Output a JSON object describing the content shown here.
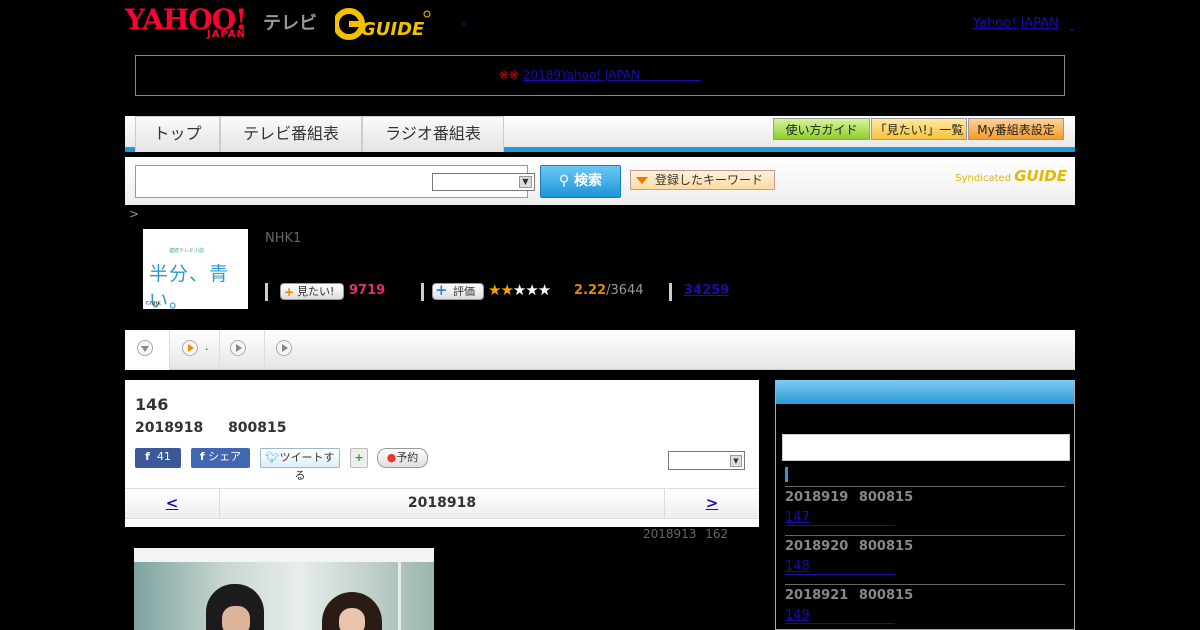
{
  "header": {
    "logo_yahoo": "YAHOO!",
    "logo_japan": "JAPAN",
    "logo_tv": "テレビ",
    "link": "Yahoo! JAPAN"
  },
  "notice": {
    "mark": "※※",
    "link": "20189Yahoo! JAPAN"
  },
  "nav": {
    "tabs": [
      "トップ",
      "テレビ番組表",
      "ラジオ番組表"
    ],
    "buttons": [
      "使い方ガイド",
      "「見たい!」一覧",
      "My番組表設定"
    ]
  },
  "search": {
    "button": "検索",
    "keyword": "登録したキーワード",
    "syndicated": "Syndicated",
    "syndicated_logo": "GUIDE"
  },
  "breadcrumb": ">",
  "program": {
    "thumb_small": "連続テレビ小説",
    "thumb_title": "半分、青い。",
    "thumb_copy": "©NHK",
    "channel": "NHK1",
    "want_label": "見たい!",
    "want_count": "9719",
    "rate_label": "評価",
    "rating": 2.22,
    "rating_text": "2.22",
    "rating_votes": "/3644",
    "reviews": "34259"
  },
  "player": {
    "sep": "."
  },
  "episode": {
    "number": "146",
    "datetime": "2018918 800815",
    "fb_count": "41",
    "fb_share": "シェア",
    "tweet": "ツイートする",
    "reserve": "予約",
    "prev": "<",
    "next": ">",
    "date": "2018918",
    "original": "2018913 162"
  },
  "sidebar": {
    "items": [
      {
        "date": "2018919 800815",
        "episode": "147"
      },
      {
        "date": "2018920 800815",
        "episode": "148"
      },
      {
        "date": "2018921 800815",
        "episode": "149"
      }
    ]
  },
  "colors": {
    "accent": "#1f9bd6",
    "brand_red": "#ff0033",
    "want_pink": "#e0336e",
    "star_orange": "#f5a300"
  }
}
